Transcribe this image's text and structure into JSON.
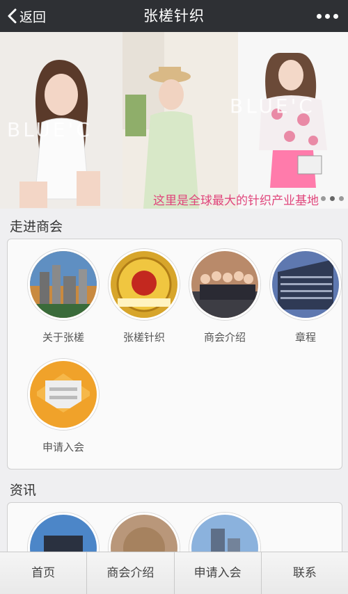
{
  "header": {
    "back_label": "返回",
    "title": "张槎针织"
  },
  "banner": {
    "caption": "这里是全球最大的针织产业基地",
    "watermark": "BLUE'C",
    "dots": 3,
    "active_dot": 1
  },
  "section1": {
    "title": "走进商会",
    "items": [
      {
        "label": "关于张槎",
        "icon": "city-skyline-photo"
      },
      {
        "label": "张槎针织",
        "icon": "knitting-badge-photo"
      },
      {
        "label": "商会介绍",
        "icon": "group-photo"
      },
      {
        "label": "章程",
        "icon": "building-photo"
      },
      {
        "label": "申请入会",
        "icon": "envelope-icon"
      }
    ]
  },
  "section2": {
    "title": "资讯"
  },
  "tabs": [
    "首页",
    "商会介绍",
    "申请入会",
    "联系"
  ],
  "colors": {
    "topbar": "#2e3034",
    "caption": "#e0457b",
    "envelope": "#f0a22a"
  }
}
